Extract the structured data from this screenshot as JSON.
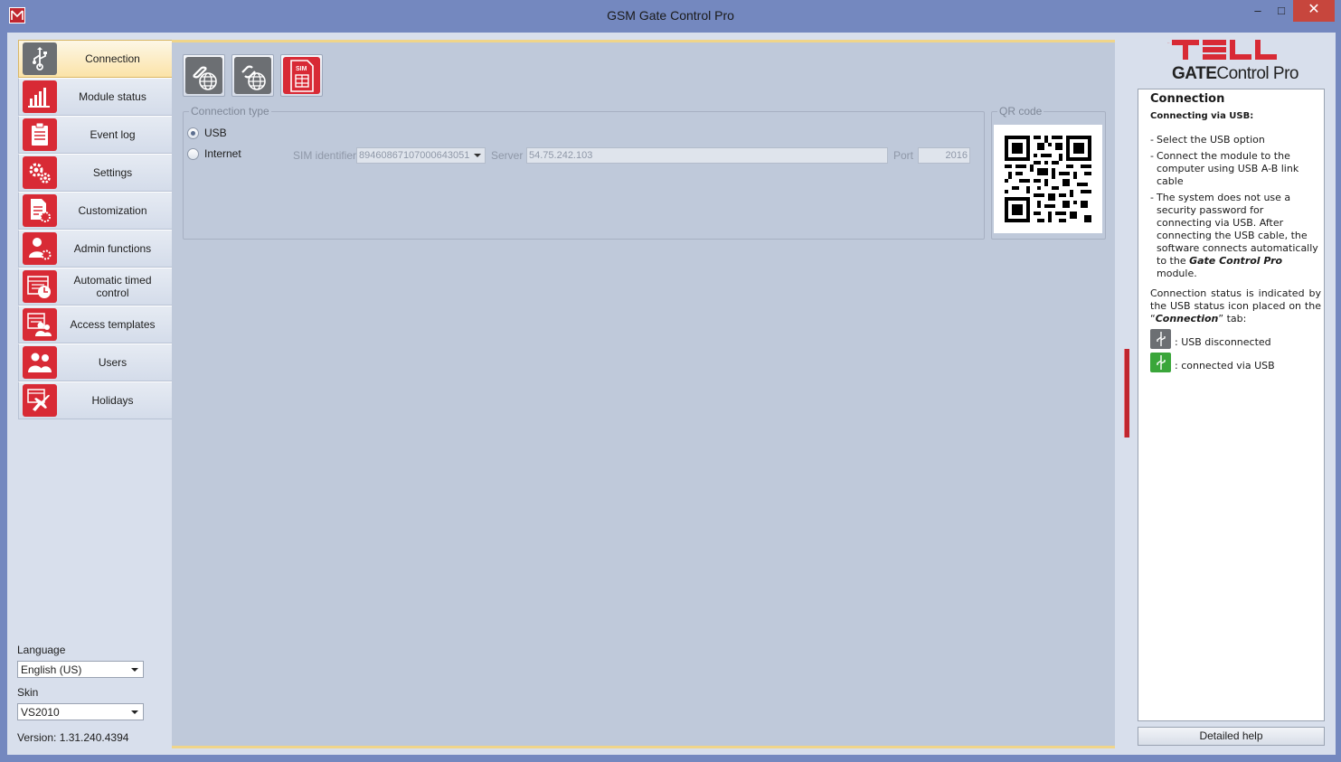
{
  "window": {
    "title": "GSM Gate Control Pro",
    "minimize_label": "–",
    "maximize_label": "□",
    "close_label": "✕"
  },
  "sidebar": {
    "items": [
      {
        "label": "Connection",
        "icon": "usb-icon",
        "active": true
      },
      {
        "label": "Module status",
        "icon": "bar-chart-icon"
      },
      {
        "label": "Event log",
        "icon": "clipboard-icon"
      },
      {
        "label": "Settings",
        "icon": "gears-icon"
      },
      {
        "label": "Customization",
        "icon": "document-gear-icon"
      },
      {
        "label": "Admin functions",
        "icon": "admin-user-icon"
      },
      {
        "label": "Automatic timed control",
        "icon": "calendar-clock-icon"
      },
      {
        "label": "Access templates",
        "icon": "calendar-users-icon"
      },
      {
        "label": "Users",
        "icon": "users-icon"
      },
      {
        "label": "Holidays",
        "icon": "calendar-plane-icon"
      }
    ],
    "language_label": "Language",
    "language_value": "English (US)",
    "skin_label": "Skin",
    "skin_value": "VS2010",
    "version": "Version: 1.31.240.4394"
  },
  "toolbar": {
    "buttons": [
      {
        "icon": "link-globe-icon"
      },
      {
        "icon": "broken-link-globe-icon"
      },
      {
        "icon": "sim-card-icon",
        "badge": "SIM"
      }
    ]
  },
  "connection": {
    "group_label": "Connection type",
    "options": [
      {
        "label": "USB",
        "checked": true
      },
      {
        "label": "Internet",
        "checked": false
      }
    ],
    "sim_label": "SIM identifier",
    "sim_value": "89460867107000643051",
    "server_label": "Server",
    "server_value": "54.75.242.103",
    "port_label": "Port",
    "port_value": "2016"
  },
  "qr": {
    "group_label": "QR code"
  },
  "help": {
    "logo_text": "TELL",
    "logo_gate": "GATE",
    "logo_control": "Control Pro",
    "title": "Connection",
    "subtitle": "Connecting via USB:",
    "bullets": [
      "Select the USB option",
      "Connect the module to the computer using USB A-B link cable",
      "The system does not use a security password for connecting via USB. After connecting the USB cable, the software connects automatically to the"
    ],
    "bullet3_bold": "Gate Control Pro",
    "bullet3_tail": " module.",
    "status_para_a": "Connection status is indicated by the USB status icon placed on the “",
    "status_para_bold": "Connection",
    "status_para_b": "” tab:",
    "status_disconnected": ": USB disconnected",
    "status_connected": ": connected via USB",
    "detailed_help_label": "Detailed help"
  },
  "colors": {
    "accent_red": "#d82a35",
    "title_bar": "#7488bf",
    "active_tab": "#fbe3a8",
    "usb_connected": "#3aa63a",
    "usb_disconnected": "#6c6f73"
  }
}
